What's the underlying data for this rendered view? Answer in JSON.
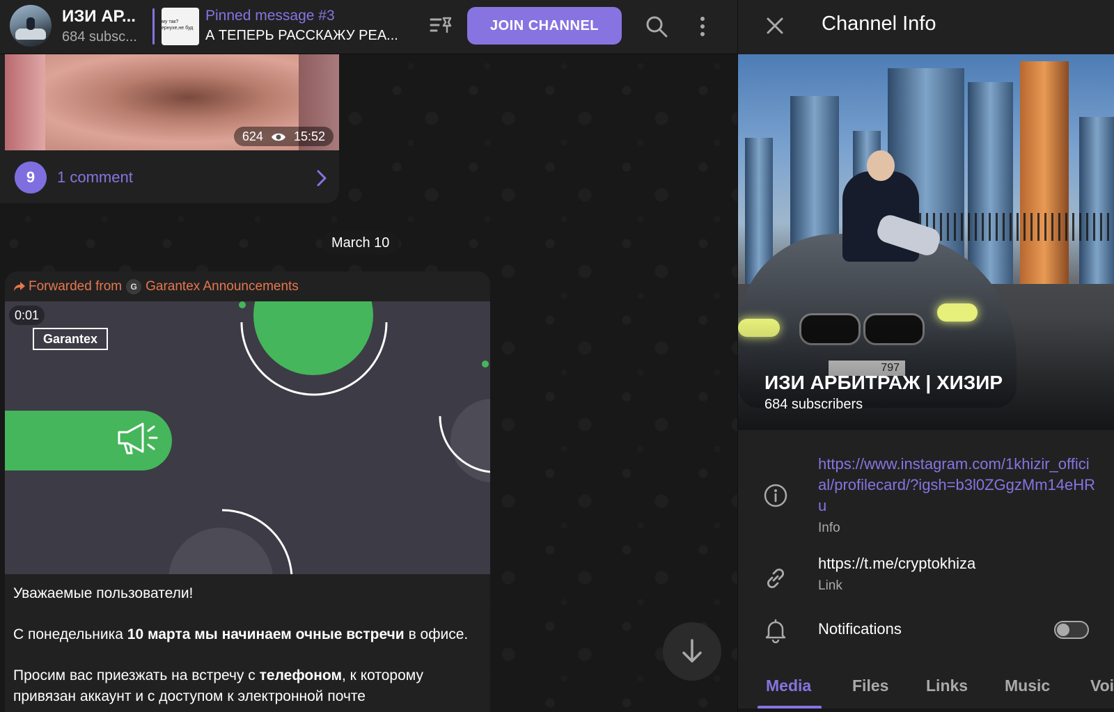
{
  "chat": {
    "header": {
      "title": "ИЗИ АР...",
      "subscribers": "684 subsc...",
      "pinned_title": "Pinned message #3",
      "pinned_text": "А ТЕПЕРЬ РАССКАЖУ РЕА...",
      "pinned_thumb_line1": "му так?",
      "pinned_thumb_line2": "ернухе,не буд",
      "join_label": "JOIN CHANNEL"
    },
    "message1": {
      "views": "624",
      "time": "15:52",
      "commenter_initial": "9",
      "comments_label": "1 comment"
    },
    "date_separator": "March 10",
    "message2": {
      "forwarded_label": "Forwarded from",
      "forwarded_source_initial": "G",
      "forwarded_source": "Garantex Announcements",
      "video_duration": "0:01",
      "video_logo_text": "Garantex",
      "text_line1": "Уважаемые пользователи!",
      "para2_a": "С понедельника ",
      "para2_b": "10 марта мы начинаем очные встречи",
      "para2_c": " в офисе.",
      "para3_a": "Просим вас приезжать на встречу с ",
      "para3_b": "телефоном",
      "para3_c": ", к которому привязан аккаунт и с доступом к электронной почте"
    }
  },
  "info_panel": {
    "title": "Channel Info",
    "channel_name": "ИЗИ АРБИТРАЖ | ХИЗИР",
    "subscribers": "684 subscribers",
    "plate_text": "797",
    "info_value": "https://www.instagram.com/1khizir_official/profilecard/?igsh=b3l0ZGgzMm14eHRu",
    "info_label": "Info",
    "link_value": "https://t.me/cryptokhiza",
    "link_label": "Link",
    "notifications_label": "Notifications",
    "notifications_on": false,
    "tabs": [
      "Media",
      "Files",
      "Links",
      "Music",
      "Voi"
    ]
  },
  "colors": {
    "accent": "#8774e1",
    "forward": "#e8774f",
    "background": "#181818",
    "panel": "#212121"
  },
  "icons": [
    "close-icon",
    "search-icon",
    "more-vertical-icon",
    "pinned-list-icon",
    "eye-icon",
    "chevron-right-icon",
    "forward-arrow-icon",
    "megaphone-icon",
    "info-icon",
    "link-icon",
    "bell-icon",
    "arrow-down-icon"
  ]
}
